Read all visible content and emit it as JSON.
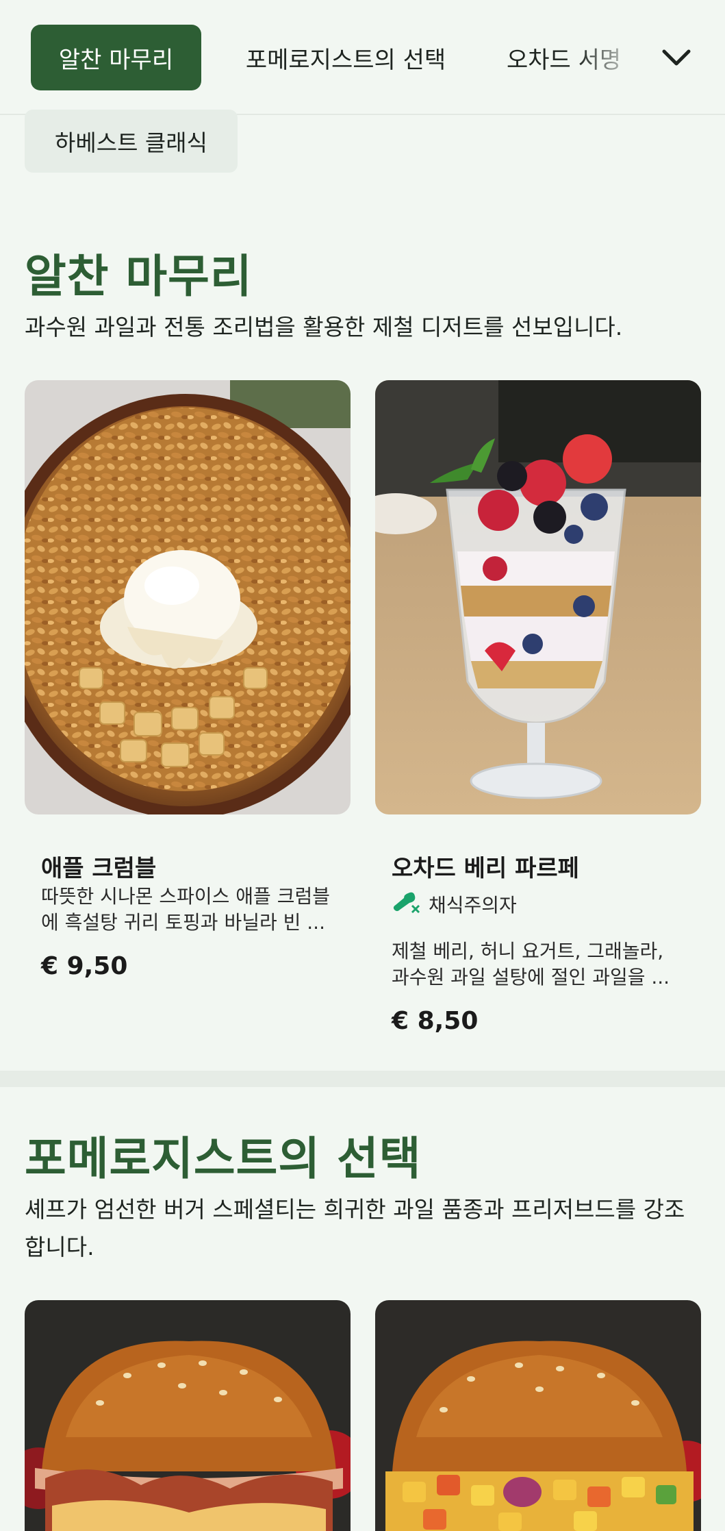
{
  "nav": {
    "tabs": [
      {
        "label": "알찬 마무리",
        "active": true
      },
      {
        "label": "포메로지스트의 선택",
        "active": false
      },
      {
        "label": "오차드 서명",
        "active": false
      }
    ],
    "expand_icon": "chevron-down-icon",
    "chip_label": "하베스트 클래식"
  },
  "sections": [
    {
      "title": "알찬 마무리",
      "description": "과수원 과일과 전통 조리법을 활용한 제철 디저트를 선보입니다.",
      "items": [
        {
          "name": "애플 크럼블",
          "description": "따뜻한 시나몬 스파이스 애플 크럼블에 흑설탕 귀리 토핑과 바닐라 빈 ...",
          "price": "€ 9,50"
        },
        {
          "name": "오차드 베리 파르페",
          "badge": "채식주의자",
          "badge_icon": "vegetarian-drumstick-crossed-icon",
          "description": "제철 베리, 허니 요거트, 그래놀라, 과수원 과일 설탕에 절인 과일을 ...",
          "price": "€ 8,50"
        }
      ]
    },
    {
      "title": "포메로지스트의 선택",
      "description": "셰프가 엄선한 버거 스페셜티는 희귀한 과일 품종과 프리저브드를 강조합니다."
    }
  ],
  "colors": {
    "accent": "#2d5e34",
    "background": "#f2f7f2",
    "badge_green": "#1aa36b"
  }
}
